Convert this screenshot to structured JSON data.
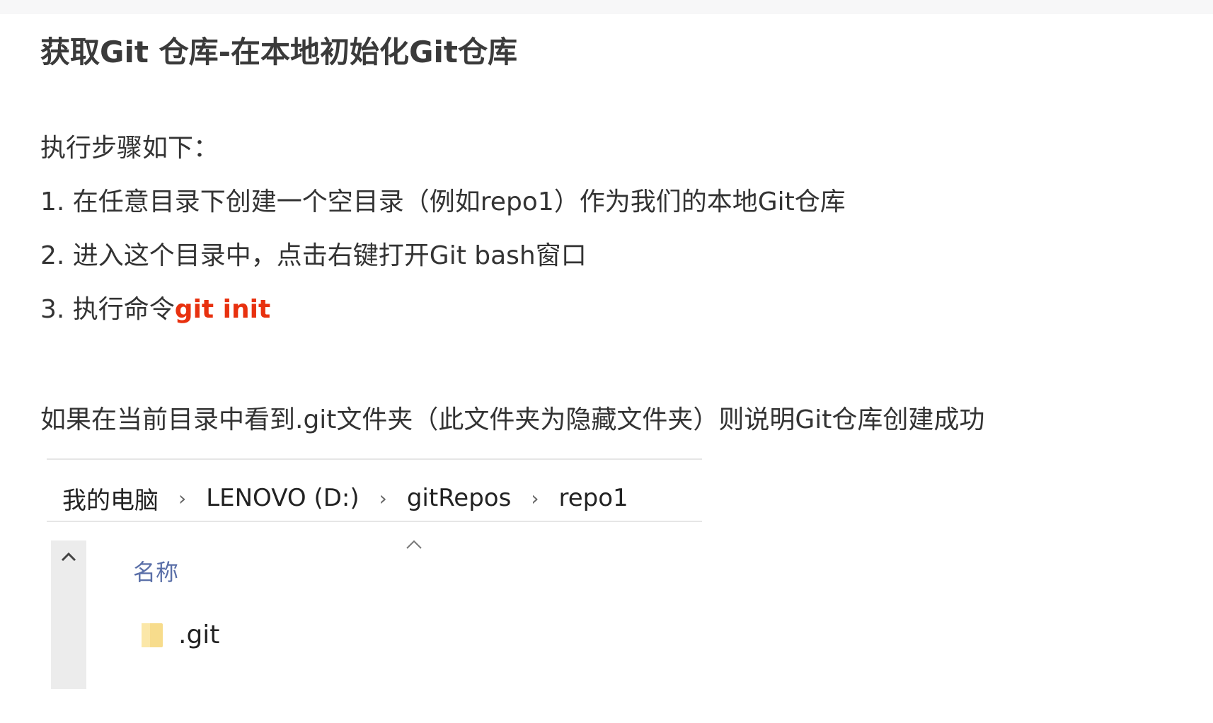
{
  "title": "获取Git 仓库-在本地初始化Git仓库",
  "intro": "执行步骤如下：",
  "steps": [
    "1. 在任意目录下创建一个空目录（例如repo1）作为我们的本地Git仓库",
    "2. 进入这个目录中，点击右键打开Git bash窗口",
    "3. 执行命令"
  ],
  "command": "git init",
  "note": "如果在当前目录中看到.git文件夹（此文件夹为隐藏文件夹）则说明Git仓库创建成功",
  "explorer": {
    "breadcrumb": [
      "我的电脑",
      "LENOVO (D:)",
      "gitRepos",
      "repo1"
    ],
    "separator": "›",
    "column_header": "名称",
    "files": [
      {
        "name": ".git",
        "icon": "folder-icon"
      }
    ]
  },
  "colors": {
    "command": "#e8310f",
    "column_header": "#5a6fa8",
    "folder": "#f7dc8c"
  }
}
